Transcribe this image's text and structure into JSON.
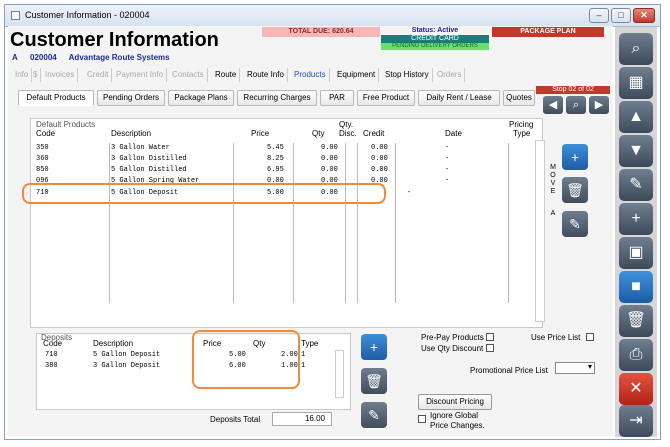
{
  "window": {
    "title": "Customer Information - 020004",
    "minimize": "–",
    "maximize": "□",
    "close": "✕"
  },
  "header": {
    "title": "Customer Information",
    "total_due": "TOTAL DUE: 620.64",
    "status": "Status: Active",
    "credit_card": "CREDIT CARD",
    "pending_delivery": "PENDING DELIVERY ORDERS",
    "package_plan": "PACKAGE PLAN",
    "account_letter": "A",
    "account_number": "020004",
    "account_name": "Advantage Route Systems"
  },
  "tabs": [
    "Info",
    "$",
    "Invoices",
    "Credit",
    "Payment Info",
    "Contacts",
    "Route",
    "Route Info",
    "Products",
    "Equipment",
    "Stop History",
    "Orders"
  ],
  "subtabs": [
    "Default Products",
    "Pending Orders",
    "Package Plans",
    "Recurring Charges",
    "PAR",
    "Free Product",
    "Daily Rent / Lease",
    "Quotes"
  ],
  "stop_nav": {
    "label": "Stop",
    "current": "02",
    "of": "of",
    "total": "02",
    "prev_icon": "arrow-left-icon",
    "search_icon": "search-icon",
    "next_icon": "arrow-right-icon"
  },
  "products": {
    "legend": "Default Products",
    "headers": {
      "code": "Code",
      "description": "Description",
      "price": "Price",
      "qty_top": "Qty.",
      "qty": "Qty",
      "disc": "Disc.",
      "credit": "Credit",
      "date": "Date",
      "pricing_top": "Pricing",
      "type": "Type"
    },
    "rows": [
      {
        "code": "350",
        "description": "3 Gallon Water",
        "price": "5.45",
        "qty": "0.00",
        "credit": "0.00",
        "date": "-"
      },
      {
        "code": "360",
        "description": "3 Gallon Distilled",
        "price": "8.25",
        "qty": "0.00",
        "credit": "0.00",
        "date": "-"
      },
      {
        "code": "850",
        "description": "5 Gallon Distilled",
        "price": "6.95",
        "qty": "0.00",
        "credit": "0.00",
        "date": "-"
      },
      {
        "code": "096",
        "description": "5 Gallon Spring Water",
        "price": "0.00",
        "qty": "0.00",
        "credit": "0.00",
        "date": "-"
      },
      {
        "code": "710",
        "description": "5 Gallon Deposit",
        "price": "5.00",
        "qty": "0.00",
        "credit": "",
        "date": "-"
      }
    ],
    "move_letters": [
      "M",
      "O",
      "V",
      "E"
    ],
    "sort_label": "A"
  },
  "deposits": {
    "legend": "Deposits",
    "headers": {
      "code": "Code",
      "description": "Description",
      "price": "Price",
      "qty": "Qty",
      "type": "Type"
    },
    "rows": [
      {
        "code": "710",
        "description": "5 Gallon Deposit",
        "price": "5.00",
        "qty": "2.00",
        "type": "1"
      },
      {
        "code": "380",
        "description": "3 Gallon Deposit",
        "price": "6.00",
        "qty": "1.00",
        "type": "1"
      }
    ],
    "total_label": "Deposits Total",
    "total_value": "16.00"
  },
  "options": {
    "prepay": "Pre-Pay Products",
    "use_qty_discount": "Use Qty Discount",
    "use_price_list": "Use Price List",
    "promo_price_list": "Promotional Price List",
    "discount_pricing": "Discount Pricing",
    "ignore_global_1": "Ignore Global",
    "ignore_global_2": "Price Changes."
  },
  "colors": {
    "highlight": "#f08a3c",
    "package_plan": "#c0392b",
    "credit_card": "#1a7f7a",
    "pending_delivery": "#66e366",
    "total_due_bg": "#f7b7b7"
  },
  "rail_icons": [
    "search-icon",
    "grid-icon",
    "arrow-up-icon",
    "arrow-down-icon",
    "edit-icon",
    "add-document-icon",
    "new-card-icon",
    "save-icon",
    "trash-icon",
    "print-icon",
    "close-icon",
    "exit-icon"
  ]
}
